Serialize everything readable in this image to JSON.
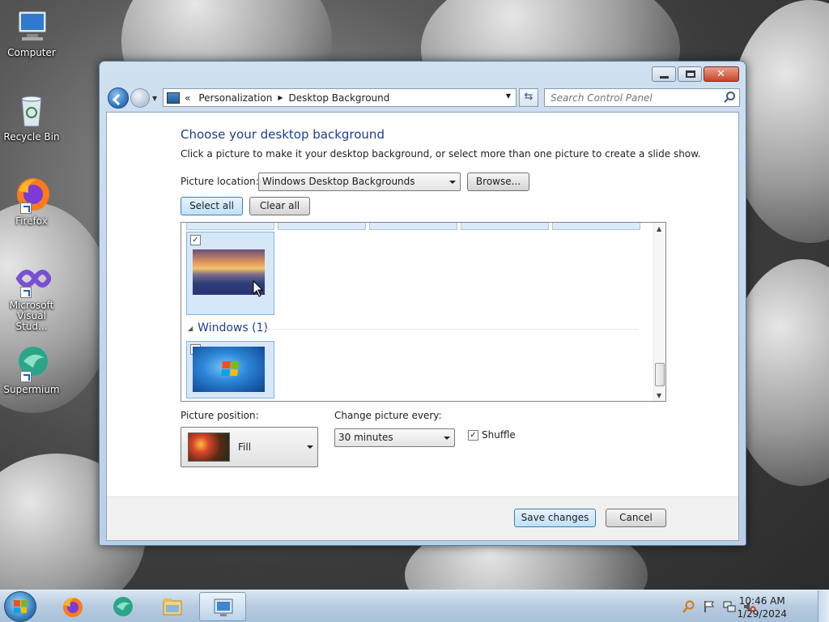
{
  "desktop": {
    "icons": [
      {
        "label": "Computer",
        "icon": "computer-icon"
      },
      {
        "label": "Recycle Bin",
        "icon": "recycle-bin-icon"
      },
      {
        "label": "Firefox",
        "icon": "firefox-icon"
      },
      {
        "label": "Microsoft Visual Stud...",
        "icon": "visual-studio-icon"
      },
      {
        "label": "Supermium",
        "icon": "supermium-icon"
      }
    ]
  },
  "window": {
    "breadcrumb": [
      "Personalization",
      "Desktop Background"
    ],
    "search_placeholder": "Search Control Panel",
    "heading": "Choose your desktop background",
    "subtext": "Click a picture to make it your desktop background, or select more than one picture to create a slide show.",
    "picture_location_label": "Picture location:",
    "picture_location_value": "Windows Desktop Backgrounds",
    "browse_label": "Browse...",
    "select_all_label": "Select all",
    "clear_all_label": "Clear all",
    "gallery": {
      "group_name": "Windows (1)"
    },
    "picture_position_label": "Picture position:",
    "picture_position_value": "Fill",
    "change_every_label": "Change picture every:",
    "change_every_value": "30 minutes",
    "shuffle_label": "Shuffle",
    "save_label": "Save changes",
    "cancel_label": "Cancel"
  },
  "taskbar": {
    "time": "10:46 AM",
    "date": "1/29/2024"
  }
}
